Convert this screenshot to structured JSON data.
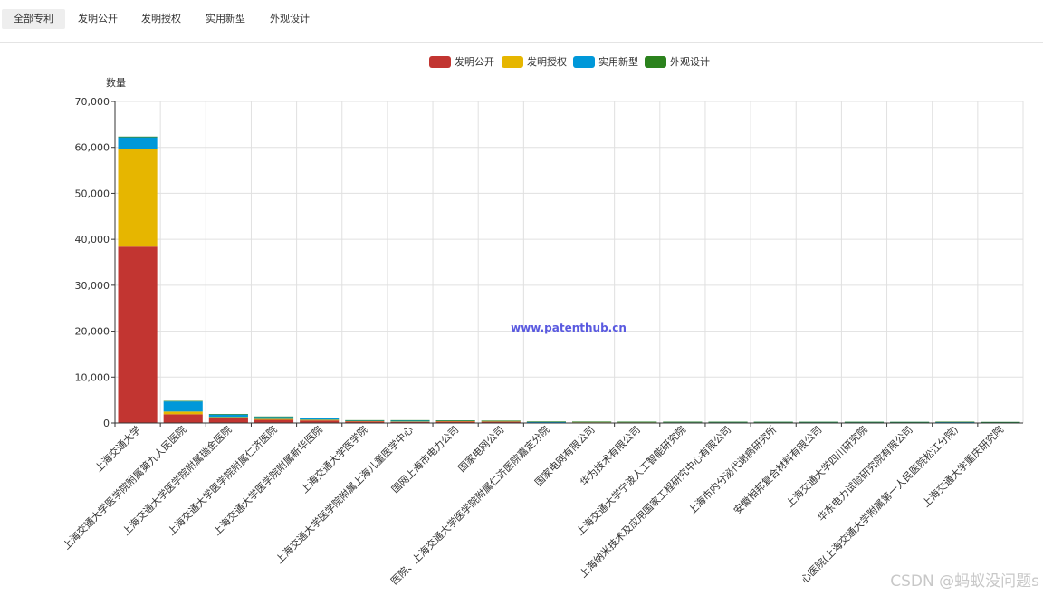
{
  "tabs": [
    "全部专利",
    "发明公开",
    "发明授权",
    "实用新型",
    "外观设计"
  ],
  "watermark": "www.patenthub.cn",
  "csdn": "CSDN @蚂蚁没问题s",
  "chart_data": {
    "type": "bar",
    "stacked": true,
    "ylabel": "数量",
    "ylim": [
      0,
      70000
    ],
    "yticks": [
      "0",
      "10,000",
      "20,000",
      "30,000",
      "40,000",
      "50,000",
      "60,000",
      "70,000"
    ],
    "grid": true,
    "legend_position": "top-center",
    "categories": [
      "上海交通大学",
      "上海交通大学医学院附属第九人民医院",
      "上海交通大学医学院附属瑞金医院",
      "上海交通大学医学院附属仁济医院",
      "上海交通大学医学院附属新华医院",
      "上海交通大学医学院",
      "上海交通大学医学院附属上海儿童医学中心",
      "国网上海市电力公司",
      "国家电网公司",
      "医院、上海交通大学医学院附属仁济医院嘉定分院",
      "国家电网有限公司",
      "华为技术有限公司",
      "上海交通大学宁波人工智能研究院",
      "上海纳米技术及应用国家工程研究中心有限公司",
      "上海市内分泌代谢病研究所",
      "安徽相邦复合材料有限公司",
      "上海交通大学四川研究院",
      "华东电力试验研究院有限公司",
      "心医院(上海交通大学附属第一人民医院松江分院)",
      "上海交通大学重庆研究院"
    ],
    "series": [
      {
        "name": "发明公开",
        "color": "#c23531",
        "values": [
          38400,
          1900,
          1000,
          700,
          550,
          350,
          250,
          330,
          280,
          60,
          130,
          120,
          110,
          100,
          100,
          90,
          90,
          80,
          60,
          70
        ]
      },
      {
        "name": "发明授权",
        "color": "#e6b600",
        "values": [
          21300,
          600,
          300,
          200,
          160,
          60,
          80,
          100,
          80,
          20,
          40,
          40,
          30,
          30,
          30,
          30,
          30,
          30,
          20,
          20
        ]
      },
      {
        "name": "实用新型",
        "color": "#0098d9",
        "values": [
          2500,
          2200,
          550,
          400,
          320,
          90,
          170,
          40,
          30,
          150,
          20,
          10,
          20,
          20,
          10,
          20,
          20,
          20,
          90,
          30
        ]
      },
      {
        "name": "外观设计",
        "color": "#2b821d",
        "values": [
          150,
          60,
          20,
          20,
          15,
          5,
          10,
          5,
          5,
          5,
          5,
          5,
          5,
          5,
          5,
          5,
          5,
          5,
          5,
          5
        ]
      }
    ]
  }
}
